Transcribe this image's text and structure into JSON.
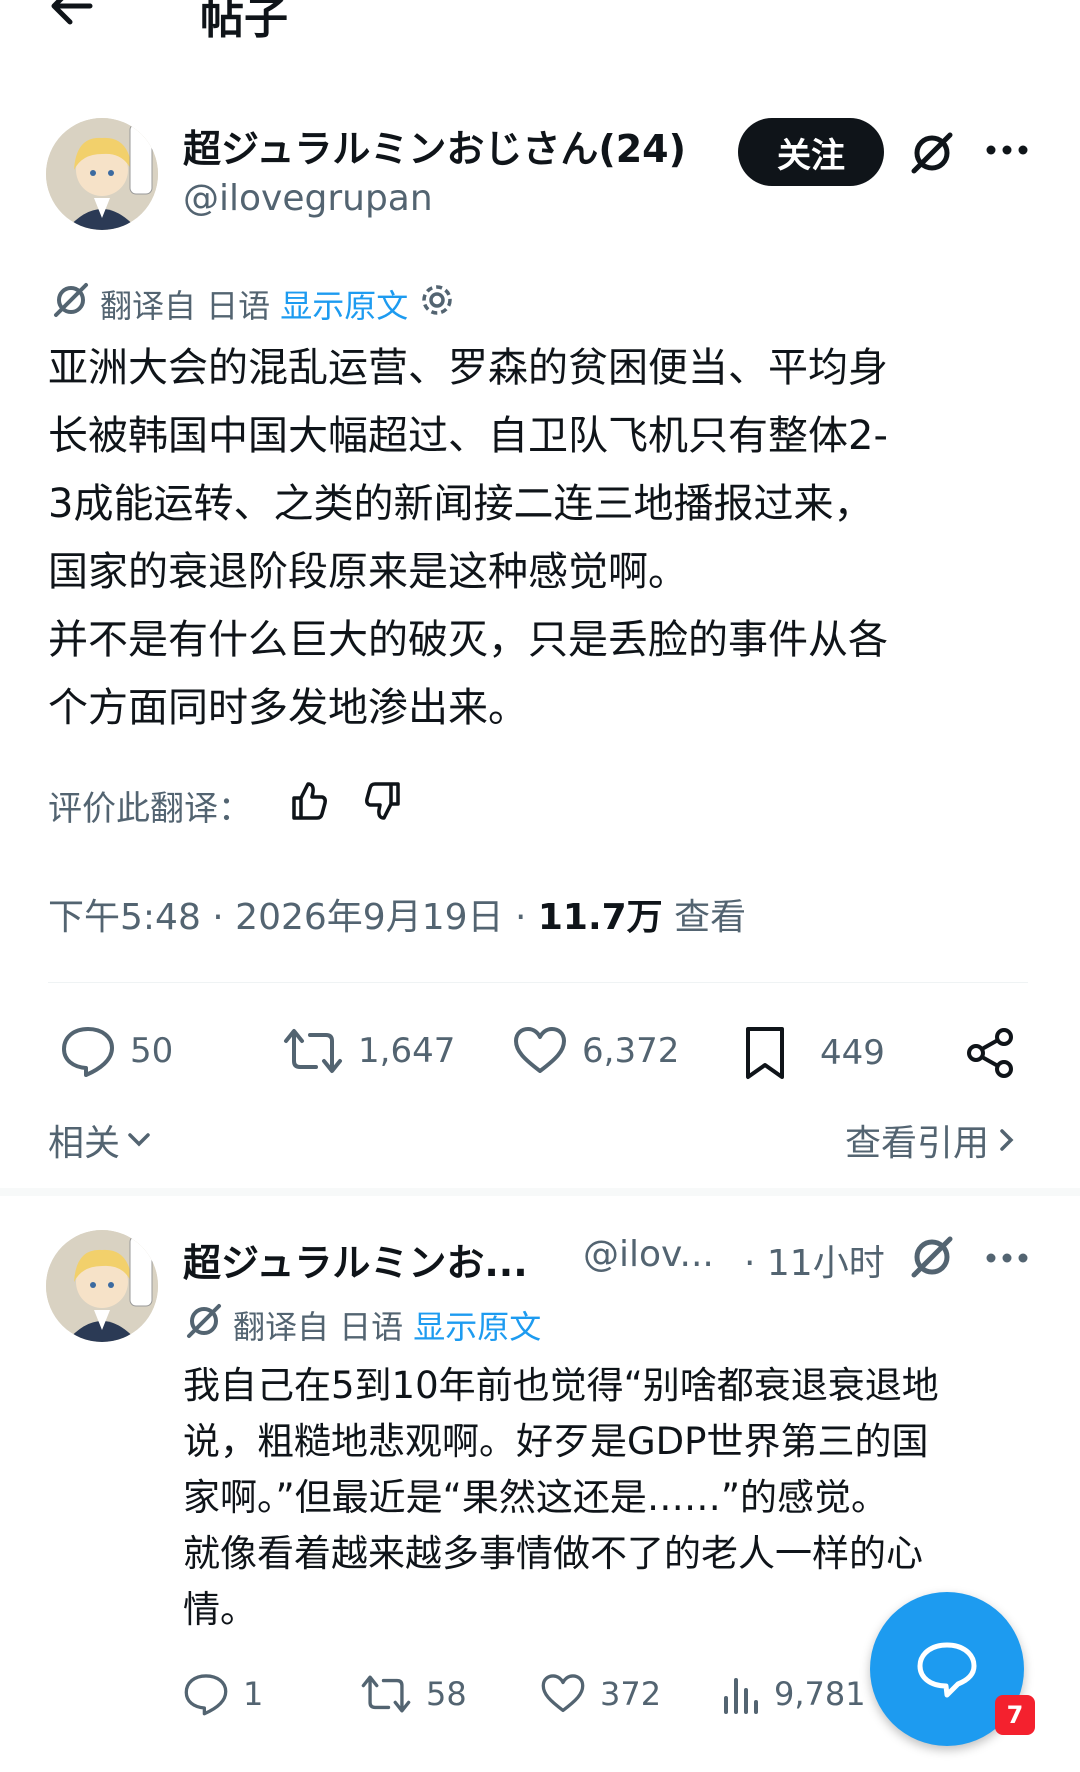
{
  "header": {
    "title": "帖子",
    "back_icon": "arrow-left-icon"
  },
  "post": {
    "author_name": "超ジュラルミンおじさん(24)",
    "handle": "@ilovegrupan",
    "follow_label": "关注",
    "translated_from": "翻译自 日语",
    "show_original": "显示原文",
    "body": "亚洲大会的混乱运营、罗森的贫困便当、平均身\n长被韩国中国大幅超过、自卫队飞机只有整体2-\n3成能运转、之类的新闻接二连三地播报过来，\n国家的衰退阶段原来是这种感觉啊。\n并不是有什么巨大的破灭，只是丢脸的事件从各\n个方面同时多发地渗出来。",
    "rate_label": "评价此翻译：",
    "time": "下午5:48 · 2026年9月19日 · ",
    "views_count": "11.7万",
    "views_label": " 查看",
    "stats": {
      "replies": "50",
      "reposts": "1,647",
      "likes": "6,372",
      "bookmarks": "449"
    },
    "related_label": "相关",
    "view_quotes_label": "查看引用"
  },
  "reply": {
    "author_name": "超ジュラルミンお...",
    "handle": "@ilov...",
    "time": "· 11小时",
    "translated_from": "翻译自 日语",
    "show_original": "显示原文",
    "body": "我自己在5到10年前也觉得“别啥都衰退衰退地\n说，粗糙地悲观啊。好歹是GDP世界第三的国\n家啊。”但最近是“果然这还是……”的感觉。\n就像看着越来越多事情做不了的老人一样的心\n情。",
    "stats": {
      "replies": "1",
      "reposts": "58",
      "likes": "372",
      "views": "9,781"
    }
  },
  "fab": {
    "badge": "7"
  },
  "colors": {
    "accent": "#1d9bf0",
    "text": "#0f1419",
    "muted": "#536471"
  }
}
